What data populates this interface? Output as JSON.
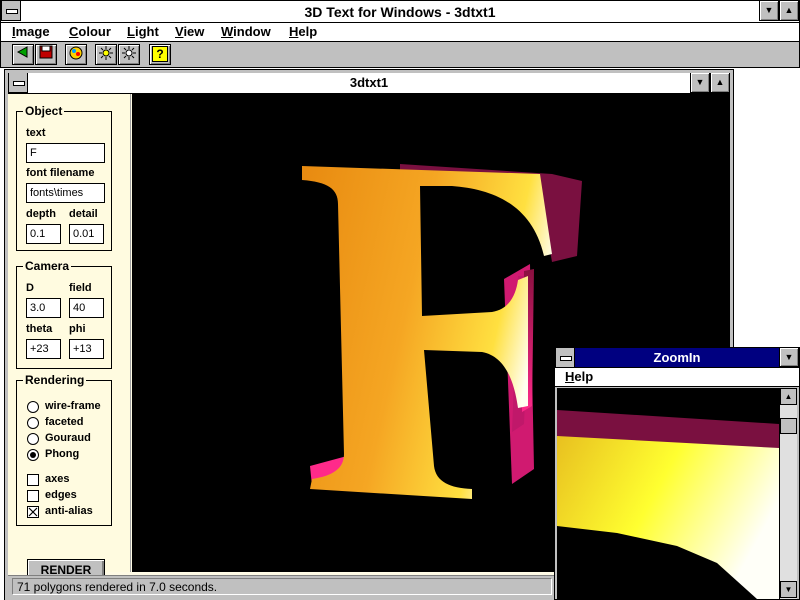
{
  "app": {
    "title": "3D Text for Windows - 3dtxt1",
    "menu": [
      "Image",
      "Colour",
      "Light",
      "View",
      "Window",
      "Help"
    ],
    "toolbar": [
      "back-icon",
      "save-icon",
      "palette-icon",
      "light-on-icon",
      "light-off-icon",
      "help-icon"
    ]
  },
  "child": {
    "title": "3dtxt1",
    "object": {
      "label": "Object",
      "text_label": "text",
      "text_value": "F",
      "font_label": "font filename",
      "font_value": "fonts\\times",
      "depth_label": "depth",
      "depth_value": "0.1",
      "detail_label": "detail",
      "detail_value": "0.01"
    },
    "camera": {
      "label": "Camera",
      "d_label": "D",
      "d_value": "3.0",
      "field_label": "field",
      "field_value": "40",
      "theta_label": "theta",
      "theta_value": "+23",
      "phi_label": "phi",
      "phi_value": "+13"
    },
    "rendering": {
      "label": "Rendering",
      "modes": [
        "wire-frame",
        "faceted",
        "Gouraud",
        "Phong"
      ],
      "selected": "Phong",
      "options": [
        "axes",
        "edges",
        "anti-alias"
      ],
      "checked": [
        "anti-alias"
      ]
    },
    "render_button": "RENDER",
    "status": "71 polygons rendered in 7.0 seconds."
  },
  "zoom": {
    "title": "ZoomIn",
    "menu_help": "Help"
  },
  "colors": {
    "letter_face": "#f5a623",
    "letter_side": "#c0185a",
    "zoom_title": "#000080"
  }
}
